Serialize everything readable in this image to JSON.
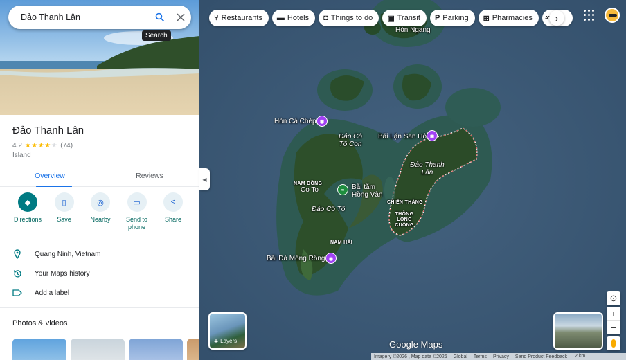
{
  "search": {
    "value": "Đảo Thanh Lân",
    "tooltip": "Search"
  },
  "place": {
    "title": "Đảo Thanh Lân",
    "rating": "4.2",
    "stars": 4.2,
    "reviews_count": "(74)",
    "category": "Island"
  },
  "tabs": [
    "Overview",
    "Reviews"
  ],
  "actions": [
    {
      "label": "Directions",
      "icon": "directions-icon"
    },
    {
      "label": "Save",
      "icon": "bookmark-icon"
    },
    {
      "label": "Nearby",
      "icon": "nearby-icon"
    },
    {
      "label": "Send to phone",
      "icon": "send-to-phone-icon"
    },
    {
      "label": "Share",
      "icon": "share-icon"
    }
  ],
  "info_rows": [
    {
      "text": "Quang Ninh, Vietnam",
      "icon": "location-pin-icon"
    },
    {
      "text": "Your Maps history",
      "icon": "history-icon"
    },
    {
      "text": "Add a label",
      "icon": "label-icon"
    }
  ],
  "photos_title": "Photos & videos",
  "chips": [
    {
      "label": "Restaurants",
      "icon": "restaurant-icon"
    },
    {
      "label": "Hotels",
      "icon": "hotel-icon"
    },
    {
      "label": "Things to do",
      "icon": "camera-icon"
    },
    {
      "label": "Transit",
      "icon": "transit-icon"
    },
    {
      "label": "Parking",
      "icon": "parking-icon"
    },
    {
      "label": "Pharmacies",
      "icon": "pharmacy-icon"
    },
    {
      "label": "ATM",
      "icon": "atm-icon"
    }
  ],
  "map_labels": {
    "hon_ngang": "Hòn Ngang",
    "hon_ca_chep": "Hòn Cá Chép",
    "dao_co_to_con": "Đảo Cô Tô Con",
    "bai_lan_san_ho": "Bãi Lặn San Hô",
    "dao_thanh_lan": "Đảo Thanh Lân",
    "nam_dong": "NAM ĐỒNG",
    "co_to": "Co To",
    "bai_tam_hong_van": "Bãi tắm Hồng Vàn",
    "chien_thang": "CHIẾN THẮNG",
    "thong_long_cuong": "THÔNG LONG CUỒNG",
    "dao_co_to": "Đảo Cô Tô",
    "nam_hai": "NAM HẢI",
    "bai_da_mong_rong": "Bãi Đá Móng Rồng"
  },
  "layers_label": "Layers",
  "logo": "Google Maps",
  "footer": {
    "imagery": "Imagery ©2026 , Map data ©2026",
    "links": [
      "Global",
      "Terms",
      "Privacy",
      "Send Product Feedback"
    ],
    "scale": "2 km"
  },
  "colors": {
    "accent": "#007b83",
    "link": "#1a73e8",
    "star": "#fbbc04",
    "ocean": "#3d5a7a"
  }
}
